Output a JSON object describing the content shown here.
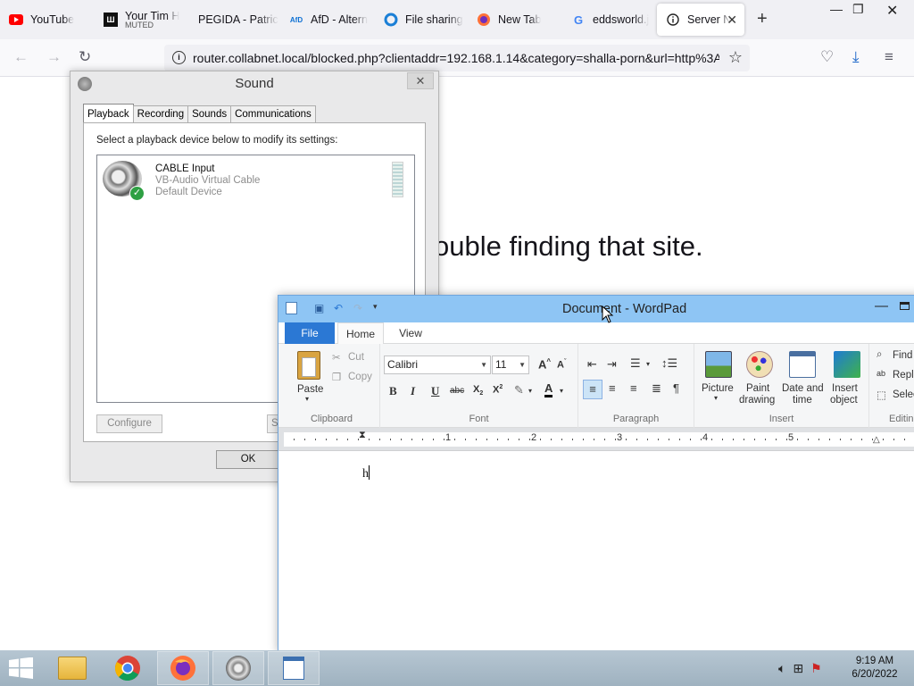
{
  "browser": {
    "tabs": [
      {
        "label": "YouTube",
        "icon": "youtube-icon"
      },
      {
        "label": "Your Tim H",
        "sublabel": "MUTED",
        "icon": "tim-icon"
      },
      {
        "label": "PEGIDA - Patric",
        "icon": "blank-icon"
      },
      {
        "label": "AfD - Altern",
        "icon": "afd-icon"
      },
      {
        "label": "File sharing",
        "icon": "fileshare-icon"
      },
      {
        "label": "New Tab",
        "icon": "firefox-icon"
      },
      {
        "label": "eddsworld.j",
        "icon": "google-icon"
      },
      {
        "label": "Server N",
        "icon": "info-icon",
        "active": true
      }
    ],
    "url": "router.collabnet.local/blocked.php?clientaddr=192.168.1.14&category=shalla-porn&url=http%3A",
    "page_heading_fragment": "ouble finding that site."
  },
  "sound_dialog": {
    "title": "Sound",
    "tabs": [
      "Playback",
      "Recording",
      "Sounds",
      "Communications"
    ],
    "active_tab": "Playback",
    "instruction": "Select a playback device below to modify its settings:",
    "device": {
      "name": "CABLE Input",
      "description": "VB-Audio Virtual Cable",
      "status": "Default Device"
    },
    "buttons": {
      "configure": "Configure",
      "set_default_fragment": "Se",
      "ok": "OK"
    }
  },
  "wordpad": {
    "title": "Document - WordPad",
    "ribbon_tabs": {
      "file": "File",
      "home": "Home",
      "view": "View"
    },
    "clipboard": {
      "group": "Clipboard",
      "paste": "Paste",
      "cut": "Cut",
      "copy": "Copy"
    },
    "font": {
      "group": "Font",
      "family": "Calibri",
      "size": "11"
    },
    "paragraph": {
      "group": "Paragraph"
    },
    "insert": {
      "group": "Insert",
      "picture": "Picture",
      "paint_line1": "Paint",
      "paint_line2": "drawing",
      "datetime_line1": "Date and",
      "datetime_line2": "time",
      "object_line1": "Insert",
      "object_line2": "object"
    },
    "editing": {
      "group": "Editin",
      "find": "Find",
      "replace": "Repl",
      "select": "Selec"
    },
    "ruler_numbers": [
      "1",
      "2",
      "3",
      "4",
      "5"
    ],
    "document_text": "h"
  },
  "taskbar": {
    "time": "9:19 AM",
    "date": "6/20/2022"
  },
  "colors": {
    "wordpad_titlebar": "#8ec5f4",
    "file_tab": "#2b78d4",
    "taskbar": "#a9bac7"
  }
}
